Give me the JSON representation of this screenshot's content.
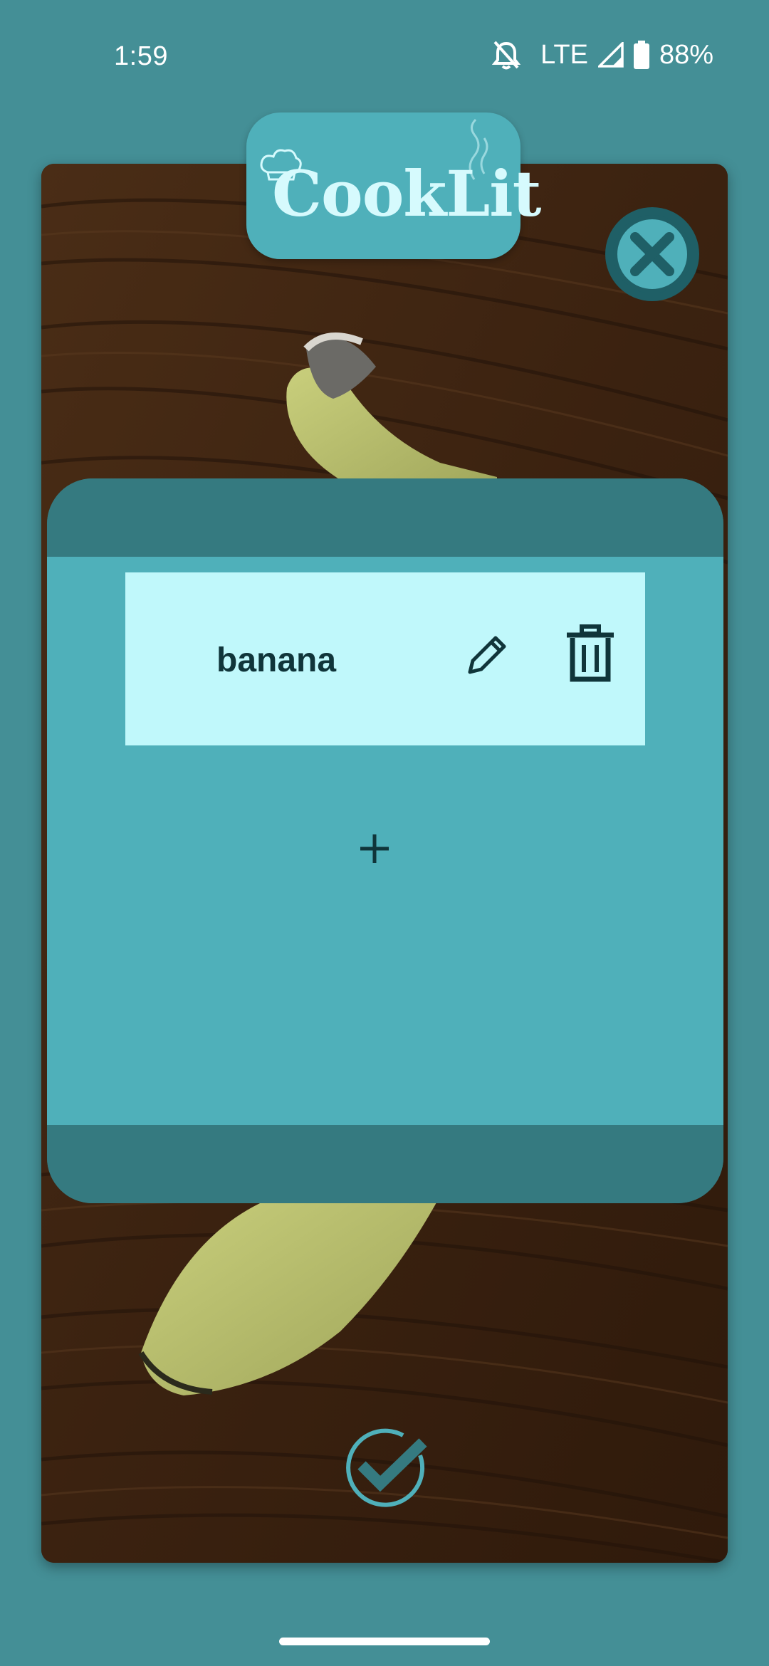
{
  "status_bar": {
    "time": "1:59",
    "network": "LTE",
    "battery": "88%",
    "icons": [
      "notifications-off-icon",
      "signal-icon",
      "battery-icon"
    ]
  },
  "app": {
    "logo_text": "CookLit",
    "logo_icons": [
      "chef-hat-icon",
      "steam-icon"
    ]
  },
  "close": {
    "icon": "close-circle-icon"
  },
  "ingredients": {
    "items": [
      {
        "name": "banana",
        "edit_icon": "pencil-icon",
        "delete_icon": "trash-icon"
      }
    ],
    "add_icon": "plus-icon"
  },
  "confirm": {
    "icon": "check-circle-icon"
  },
  "colors": {
    "background": "#448f96",
    "accent": "#4fb0ba",
    "panel_dark": "#357a80",
    "item_bg": "#c0f8fb",
    "text_dark": "#10353a",
    "logo_text": "#d6fafd"
  }
}
